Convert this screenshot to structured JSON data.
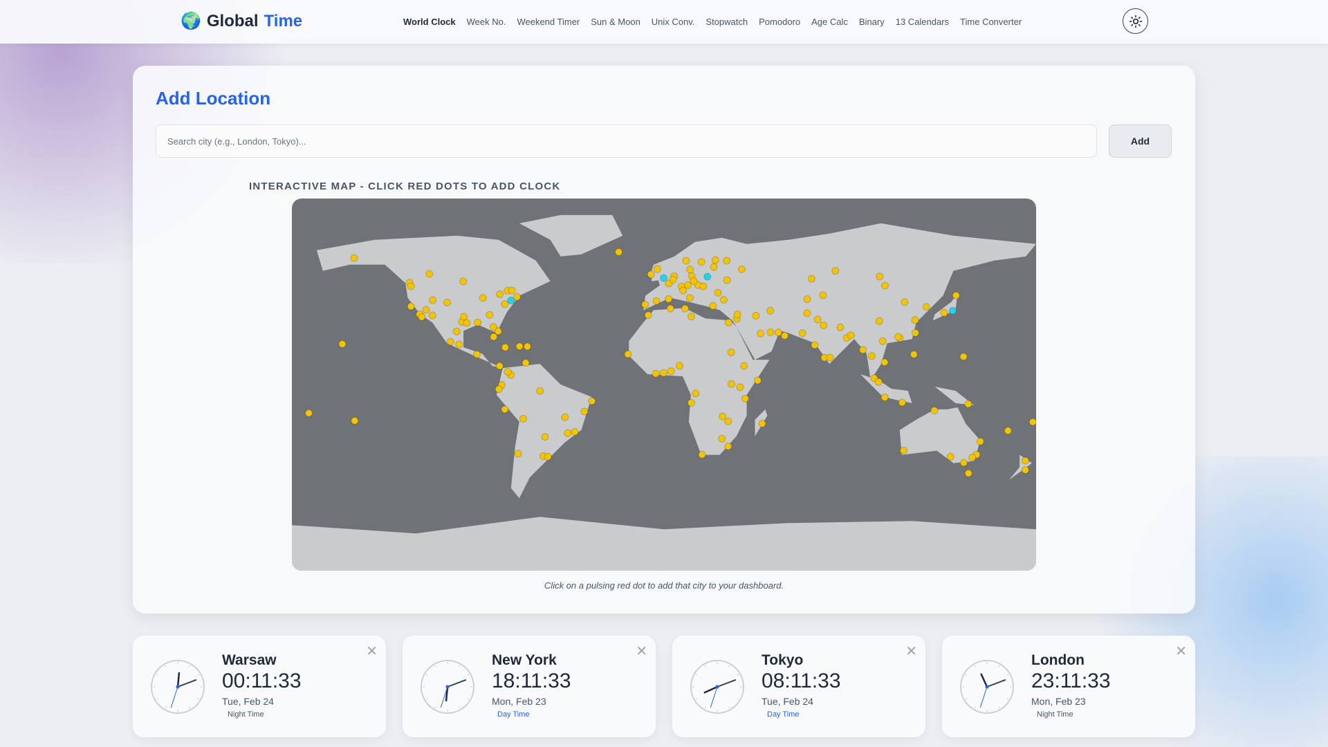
{
  "brand": {
    "icon": "globe-emoji",
    "emoji": "🌍",
    "word1": "Global",
    "word2": "Time"
  },
  "nav": [
    "World Clock",
    "Week No.",
    "Weekend Timer",
    "Sun & Moon",
    "Unix Conv.",
    "Stopwatch",
    "Pomodoro",
    "Age Calc",
    "Binary",
    "13 Calendars",
    "Time Converter"
  ],
  "add": {
    "title": "Add Location",
    "placeholder": "Search city (e.g., London, Tokyo)...",
    "button": "Add"
  },
  "map": {
    "label": "INTERACTIVE MAP - CLICK RED DOTS TO ADD CLOCK",
    "caption": "Click on a pulsing red dot to add that city to your dashboard.",
    "colors": {
      "dot": "#f5c400",
      "active": "#22d3ee",
      "land": "#c9cbcd",
      "sea": "#6f7378"
    },
    "active_cities": [
      [
        -0.1,
        51.5
      ],
      [
        21,
        52.2
      ],
      [
        -74,
        40.7
      ],
      [
        139.7,
        35.7
      ]
    ],
    "cities": [
      [
        -149.9,
        61.2
      ],
      [
        -123.1,
        49.3
      ],
      [
        -122.4,
        47.6
      ],
      [
        -122.4,
        37.8
      ],
      [
        -118.2,
        34
      ],
      [
        -117.2,
        32.7
      ],
      [
        -115.1,
        36.2
      ],
      [
        -112,
        33.4
      ],
      [
        -111.9,
        40.8
      ],
      [
        -104.9,
        39.7
      ],
      [
        -97.7,
        30.3
      ],
      [
        -96.8,
        32.8
      ],
      [
        -95.4,
        29.8
      ],
      [
        -90.1,
        30
      ],
      [
        -87.6,
        41.9
      ],
      [
        -84.4,
        33.7
      ],
      [
        -80.2,
        25.8
      ],
      [
        -82.5,
        27.9
      ],
      [
        -79.4,
        43.7
      ],
      [
        -75.7,
        45.4
      ],
      [
        -73.6,
        45.5
      ],
      [
        -71.1,
        42.4
      ],
      [
        -77,
        38.9
      ],
      [
        -113.5,
        53.5
      ],
      [
        -97.1,
        49.9
      ],
      [
        -99.1,
        19.4
      ],
      [
        -103.3,
        20.7
      ],
      [
        -100.3,
        25.7
      ],
      [
        -90.5,
        14.6
      ],
      [
        -82.4,
        23.1
      ],
      [
        -76.8,
        18
      ],
      [
        -69.9,
        18.5
      ],
      [
        -66.1,
        18.4
      ],
      [
        -79.5,
        9
      ],
      [
        -74.1,
        4.7
      ],
      [
        -75.6,
        6.2
      ],
      [
        -66.9,
        10.5
      ],
      [
        -78.5,
        -0.2
      ],
      [
        -79.9,
        -2.2
      ],
      [
        -77,
        -12
      ],
      [
        -68.1,
        -16.5
      ],
      [
        -70.6,
        -33.4
      ],
      [
        -58.4,
        -34.6
      ],
      [
        -56.2,
        -34.9
      ],
      [
        -57.6,
        -25.3
      ],
      [
        -47.9,
        -15.8
      ],
      [
        -43.2,
        -22.9
      ],
      [
        -46.6,
        -23.5
      ],
      [
        -38.5,
        -13
      ],
      [
        -34.9,
        -8
      ],
      [
        -60,
        -3.1
      ],
      [
        -155.6,
        19.6
      ],
      [
        -149.6,
        -17.5
      ],
      [
        -21.9,
        64.1
      ],
      [
        -9.1,
        38.7
      ],
      [
        -3.7,
        40.4
      ],
      [
        2.2,
        41.4
      ],
      [
        2.35,
        48.9
      ],
      [
        4.9,
        52.4
      ],
      [
        4.4,
        50.8
      ],
      [
        8.5,
        47.4
      ],
      [
        13.4,
        52.5
      ],
      [
        11.6,
        48.1
      ],
      [
        16.4,
        48.2
      ],
      [
        14.4,
        50.1
      ],
      [
        19,
        47.5
      ],
      [
        12.5,
        41.9
      ],
      [
        9.2,
        45.5
      ],
      [
        23.7,
        38
      ],
      [
        26.1,
        44.4
      ],
      [
        28.9,
        41
      ],
      [
        30.5,
        50.5
      ],
      [
        37.6,
        55.8
      ],
      [
        30.3,
        59.9
      ],
      [
        18.1,
        59.3
      ],
      [
        10.7,
        59.9
      ],
      [
        12.6,
        55.7
      ],
      [
        24.9,
        60.2
      ],
      [
        24.1,
        56.9
      ],
      [
        -6.3,
        53.3
      ],
      [
        -3.2,
        55.9
      ],
      [
        -7.6,
        33.6
      ],
      [
        3.1,
        36.8
      ],
      [
        10.2,
        36.8
      ],
      [
        13.2,
        32.9
      ],
      [
        31.2,
        30
      ],
      [
        35.2,
        31.8
      ],
      [
        35.5,
        33.9
      ],
      [
        44.4,
        33.3
      ],
      [
        51.4,
        35.7
      ],
      [
        46.7,
        24.7
      ],
      [
        55.3,
        25.2
      ],
      [
        51.5,
        25.3
      ],
      [
        58.4,
        23.6
      ],
      [
        69.2,
        34.5
      ],
      [
        67,
        24.9
      ],
      [
        74.3,
        31.5
      ],
      [
        77.2,
        28.6
      ],
      [
        72.9,
        19.1
      ],
      [
        77.6,
        13
      ],
      [
        80.3,
        13.1
      ],
      [
        88.4,
        22.6
      ],
      [
        90.4,
        23.8
      ],
      [
        85.3,
        27.7
      ],
      [
        69.3,
        41.3
      ],
      [
        76.9,
        43.2
      ],
      [
        71.4,
        51.2
      ],
      [
        82.9,
        55
      ],
      [
        104.3,
        52.3
      ],
      [
        106.9,
        47.9
      ],
      [
        116.4,
        39.9
      ],
      [
        121.5,
        31.2
      ],
      [
        114.1,
        22.4
      ],
      [
        113.3,
        23.1
      ],
      [
        104.1,
        30.7
      ],
      [
        126.9,
        37.6
      ],
      [
        135.5,
        34.7
      ],
      [
        141.3,
        43.1
      ],
      [
        121.6,
        25
      ],
      [
        120.9,
        14.6
      ],
      [
        106.7,
        10.8
      ],
      [
        105.8,
        21
      ],
      [
        100.5,
        13.8
      ],
      [
        96.2,
        16.8
      ],
      [
        101.7,
        3.1
      ],
      [
        103.8,
        1.3
      ],
      [
        106.8,
        -6.2
      ],
      [
        115.2,
        -8.7
      ],
      [
        144.9,
        13.5
      ],
      [
        147.2,
        -9.4
      ],
      [
        -17.4,
        14.7
      ],
      [
        -4,
        5.3
      ],
      [
        -0.2,
        5.6
      ],
      [
        3.4,
        6.5
      ],
      [
        7.5,
        9.1
      ],
      [
        38.7,
        9
      ],
      [
        32.6,
        0.3
      ],
      [
        36.8,
        -1.3
      ],
      [
        39.3,
        -6.8
      ],
      [
        15.3,
        -4.3
      ],
      [
        13.2,
        -8.8
      ],
      [
        28.3,
        -15.4
      ],
      [
        31,
        -17.8
      ],
      [
        28,
        -26.2
      ],
      [
        31,
        -29.9
      ],
      [
        18.4,
        -33.9
      ],
      [
        47.5,
        -18.9
      ],
      [
        32.5,
        15.6
      ],
      [
        45.3,
        2
      ],
      [
        115.9,
        -31.9
      ],
      [
        130.8,
        -12.5
      ],
      [
        153,
        -27.5
      ],
      [
        151.2,
        -33.9
      ],
      [
        149.1,
        -35.3
      ],
      [
        145,
        -37.8
      ],
      [
        138.6,
        -34.9
      ],
      [
        147.3,
        -42.9
      ],
      [
        174.8,
        -36.8
      ],
      [
        174.8,
        -41.3
      ],
      [
        178.4,
        -18.1
      ],
      [
        166.4,
        -22.3
      ],
      [
        -171.8,
        -13.8
      ]
    ]
  },
  "clocks": [
    {
      "city": "Warsaw",
      "time": "00:11:33",
      "date": "Tue, Feb 24",
      "period": "Night Time",
      "day": false
    },
    {
      "city": "New York",
      "time": "18:11:33",
      "date": "Mon, Feb 23",
      "period": "Day Time",
      "day": true
    },
    {
      "city": "Tokyo",
      "time": "08:11:33",
      "date": "Tue, Feb 24",
      "period": "Day Time",
      "day": true
    },
    {
      "city": "London",
      "time": "23:11:33",
      "date": "Mon, Feb 23",
      "period": "Night Time",
      "day": false
    }
  ],
  "close_glyph": "✕"
}
